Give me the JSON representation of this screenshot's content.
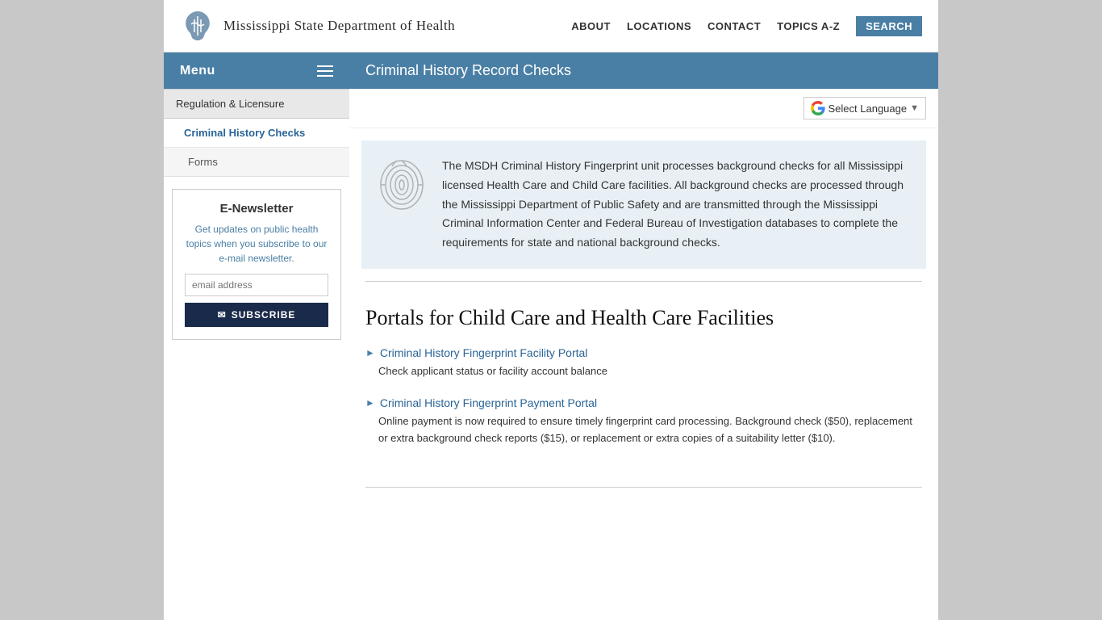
{
  "header": {
    "org_name": "Mississippi State Department of Health",
    "nav": {
      "about": "ABOUT",
      "locations": "LOCATIONS",
      "contact": "CONTACT",
      "topics": "TOPICS A-Z",
      "search": "SEARCH"
    }
  },
  "topbar": {
    "menu_label": "Menu",
    "page_title": "Criminal History Record Checks"
  },
  "sidebar": {
    "section_title": "Regulation & Licensure",
    "active_item": "Criminal History Checks",
    "sub_items": [
      "Forms"
    ]
  },
  "enewsletter": {
    "title": "E-Newsletter",
    "description": "Get updates on public health topics when you subscribe to our e-mail newsletter.",
    "email_placeholder": "email address",
    "subscribe_label": "SUBSCRIBE"
  },
  "lang_selector": {
    "label": "Select Language"
  },
  "intro": {
    "text": "The MSDH Criminal History Fingerprint unit processes background checks for all Mississippi licensed Health Care and Child Care facilities. All background checks are processed through the Mississippi Department of Public Safety and are transmitted through the Mississippi Criminal Information Center and Federal Bureau of Investigation databases to complete the requirements for state and national background checks."
  },
  "portals": {
    "title": "Portals for Child Care and Health Care Facilities",
    "items": [
      {
        "link_text": "Criminal History Fingerprint Facility Portal",
        "description": "Check applicant status or facility account balance"
      },
      {
        "link_text": "Criminal History Fingerprint Payment Portal",
        "description": "Online payment is now required to ensure timely fingerprint card processing. Background check ($50), replacement or extra background check reports ($15), or replacement or extra copies of a suitability letter ($10)."
      }
    ]
  }
}
